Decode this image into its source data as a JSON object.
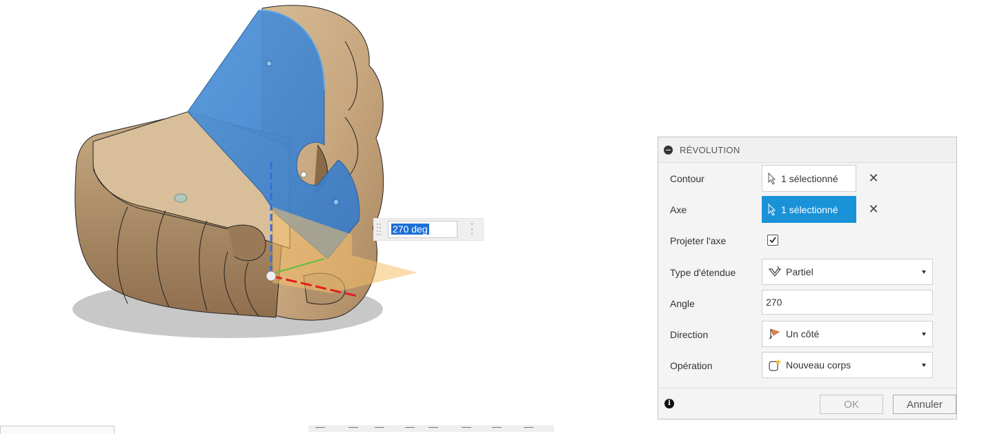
{
  "viewport": {
    "angle_input": {
      "value": "270 deg"
    }
  },
  "dialog": {
    "title": "RÉVOLUTION",
    "rows": {
      "contour": {
        "label": "Contour",
        "value": "1 sélectionné",
        "clear": "✕"
      },
      "axe": {
        "label": "Axe",
        "value": "1 sélectionné",
        "clear": "✕"
      },
      "projeter": {
        "label": "Projeter l'axe",
        "checked": true
      },
      "type": {
        "label": "Type d'étendue",
        "value": "Partiel",
        "icon": "partial-extent-icon"
      },
      "angle": {
        "label": "Angle",
        "value": "270"
      },
      "direction": {
        "label": "Direction",
        "value": "Un côté",
        "icon": "one-side-direction-icon"
      },
      "operation": {
        "label": "Opération",
        "value": "Nouveau corps",
        "icon": "new-body-icon"
      }
    },
    "buttons": {
      "ok": "OK",
      "cancel": "Annuler"
    },
    "colors": {
      "active_selection": "#1a92d8",
      "preview_body": "#3d87d2"
    }
  }
}
